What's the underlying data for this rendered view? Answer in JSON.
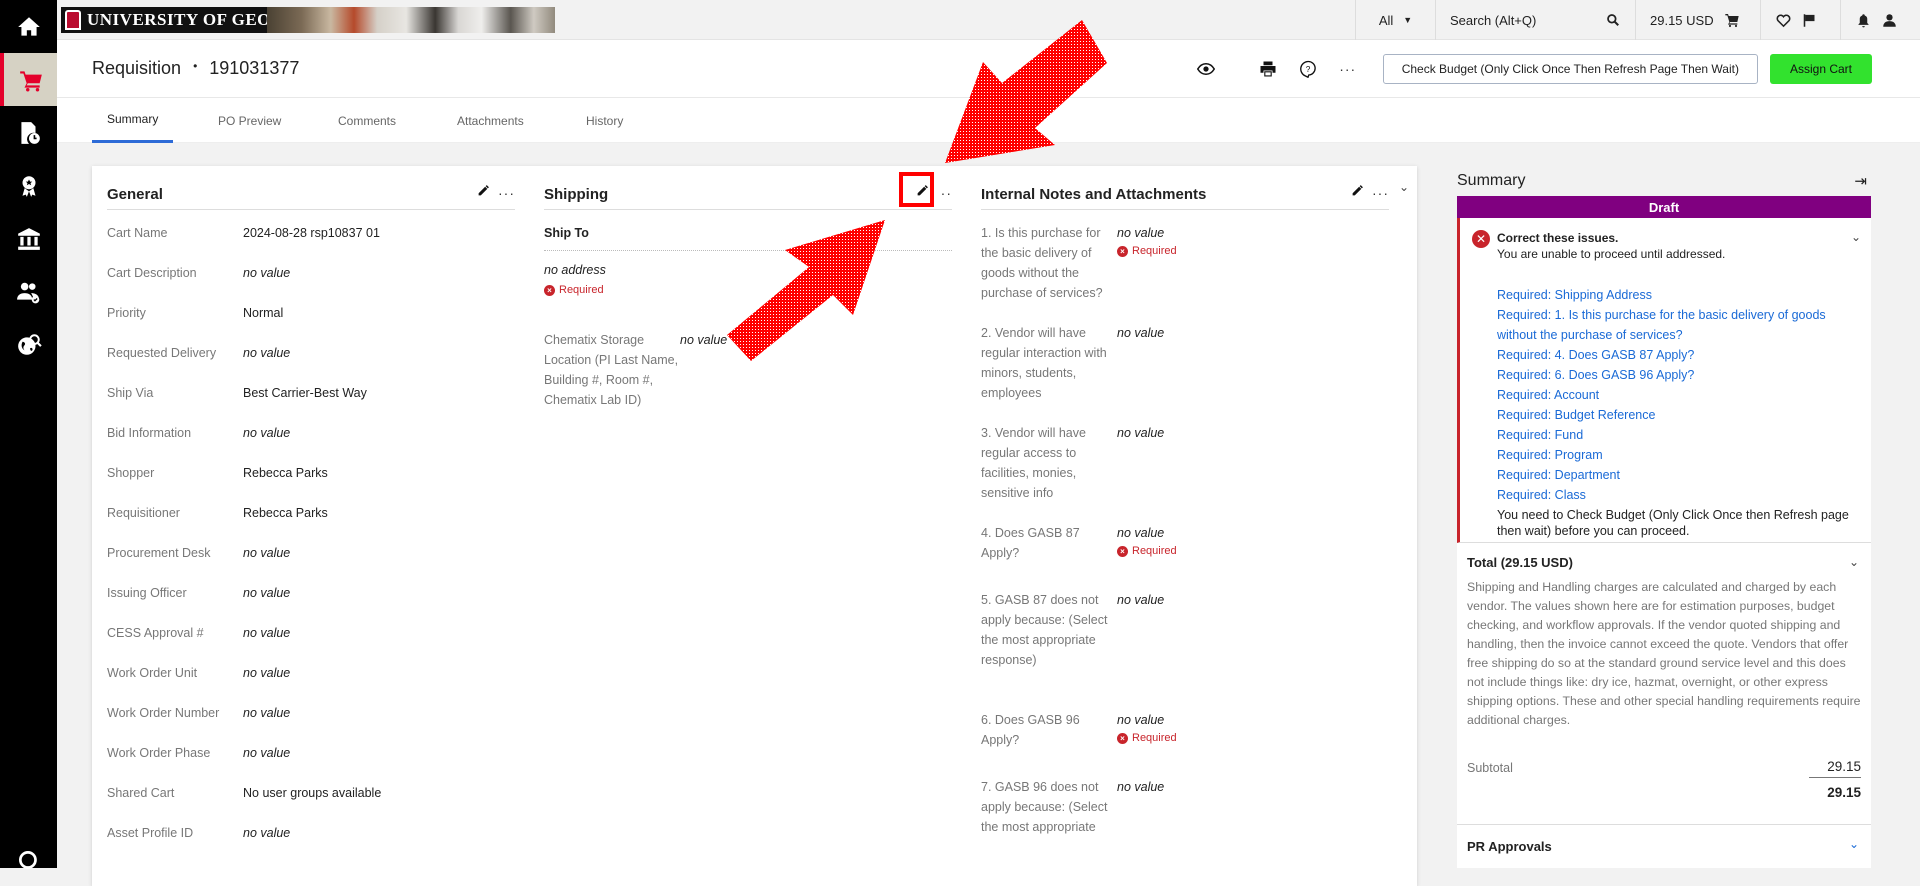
{
  "topbar": {
    "brand": "UNIVERSITY OF GEORGIA",
    "search_scope": "All",
    "search_placeholder": "Search (Alt+Q)",
    "cart_total": "29.15 USD"
  },
  "header": {
    "doc_type": "Requisition",
    "separator": "•",
    "doc_number": "191031377",
    "check_budget_label": "Check Budget (Only Click Once Then Refresh Page Then Wait)",
    "assign_cart_label": "Assign Cart"
  },
  "tabs": [
    {
      "label": "Summary",
      "active": true
    },
    {
      "label": "PO Preview",
      "active": false
    },
    {
      "label": "Comments",
      "active": false
    },
    {
      "label": "Attachments",
      "active": false
    },
    {
      "label": "History",
      "active": false
    }
  ],
  "general": {
    "title": "General",
    "fields": [
      {
        "label": "Cart Name",
        "value": "2024-08-28 rsp10837 01"
      },
      {
        "label": "Cart Description",
        "value": "no value"
      },
      {
        "label": "Priority",
        "value": "Normal"
      },
      {
        "label": "Requested Delivery",
        "value": "no value"
      },
      {
        "label": "Ship Via",
        "value": "Best Carrier-Best Way"
      },
      {
        "label": "Bid Information",
        "value": "no value"
      },
      {
        "label": "Shopper",
        "value": "Rebecca Parks"
      },
      {
        "label": "Requisitioner",
        "value": "Rebecca Parks"
      },
      {
        "label": "Procurement Desk",
        "value": "no value"
      },
      {
        "label": "Issuing Officer",
        "value": "no value"
      },
      {
        "label": "CESS Approval #",
        "value": "no value"
      },
      {
        "label": "Work Order Unit",
        "value": "no value"
      },
      {
        "label": "Work Order Number",
        "value": "no value"
      },
      {
        "label": "Work Order Phase",
        "value": "no value"
      },
      {
        "label": "Shared Cart",
        "value": "No user groups available"
      },
      {
        "label": "Asset Profile ID",
        "value": "no value"
      }
    ]
  },
  "shipping": {
    "title": "Shipping",
    "ship_to_label": "Ship To",
    "address": "no address",
    "required_label": "Required",
    "chematix_label": "Chematix Storage Location (PI Last Name, Building #, Room #, Chematix Lab ID)",
    "chematix_value": "no value"
  },
  "internal": {
    "title": "Internal Notes and Attachments",
    "questions": [
      {
        "label": "1. Is this purchase for the basic delivery of goods without the purchase of services?",
        "value": "no value",
        "required": "Required"
      },
      {
        "label": "2. Vendor will have regular interaction with minors, students, employees",
        "value": "no value",
        "required": ""
      },
      {
        "label": "3. Vendor will have regular access to facilities, monies, sensitive info",
        "value": "no value",
        "required": ""
      },
      {
        "label": "4. Does GASB 87 Apply?",
        "value": "no value",
        "required": "Required"
      },
      {
        "label": "5. GASB 87 does not apply because: (Select the most appropriate response)",
        "value": "no value",
        "required": ""
      },
      {
        "label": "6. Does GASB 96 Apply?",
        "value": "no value",
        "required": "Required"
      },
      {
        "label": "7. GASB 96 does not apply because: (Select the most appropriate",
        "value": "no value",
        "required": ""
      }
    ]
  },
  "summary": {
    "title": "Summary",
    "status": "Draft",
    "status_color": "#800080",
    "issues_title": "Correct these issues.",
    "issues_subtitle": "You are unable to proceed until addressed.",
    "issues": [
      "Required: Shipping Address",
      "Required: 1. Is this purchase for the basic delivery of goods without the purchase of services?",
      "Required: 4. Does GASB 87 Apply?",
      "Required: 6. Does GASB 96 Apply?",
      "Required: Account",
      "Required: Budget Reference",
      "Required: Fund",
      "Required: Program",
      "Required: Department",
      "Required: Class"
    ],
    "budget_note": "You need to Check Budget (Only Click Once then Refresh page then wait) before you can proceed.",
    "total_title": "Total (29.15 USD)",
    "total_text": "Shipping and Handling charges are calculated and charged by each vendor. The values shown here are for estimation purposes, budget checking, and workflow approvals. If the vendor quoted shipping and handling, then the invoice cannot exceed the quote. Vendors that offer free shipping do so at the standard ground service level and this does not include things like: dry ice, hazmat, overnight, or other express shipping options. These and other special handling requirements require additional charges.",
    "subtotal_label": "Subtotal",
    "subtotal_value": "29.15",
    "total_value": "29.15",
    "pr_approvals": "PR Approvals"
  },
  "colors": {
    "accent_blue": "#2d6bd7",
    "assign_green": "#32e22e",
    "required_red": "#c8242b",
    "annotation_red": "#ff0000"
  }
}
